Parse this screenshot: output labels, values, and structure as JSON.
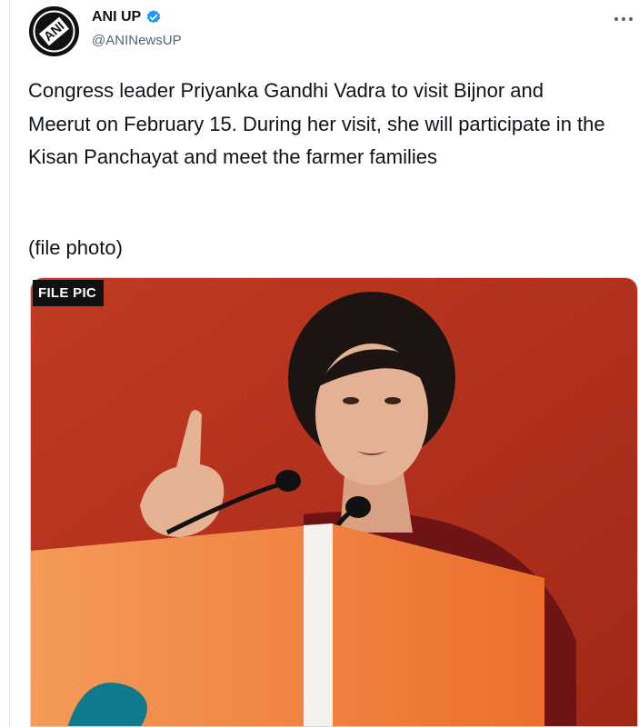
{
  "account": {
    "name": "ANI UP",
    "handle": "@ANINewsUP",
    "avatar_icon": "ani-logo-icon",
    "verified_icon": "verified-badge-icon",
    "accent": "#1d9bf0"
  },
  "tweet": {
    "text": "Congress leader Priyanka Gandhi Vadra to visit Bijnor and Meerut on February 15. During her visit, she will participate in the Kisan Panchayat and meet the farmer families",
    "note": "(file photo)"
  },
  "media": {
    "badge": "FILE PIC",
    "kind": "photo of speaker at podium",
    "background_color": "#b8321f",
    "podium_color": "#f07f3c"
  },
  "more_icon": "more-options-icon"
}
